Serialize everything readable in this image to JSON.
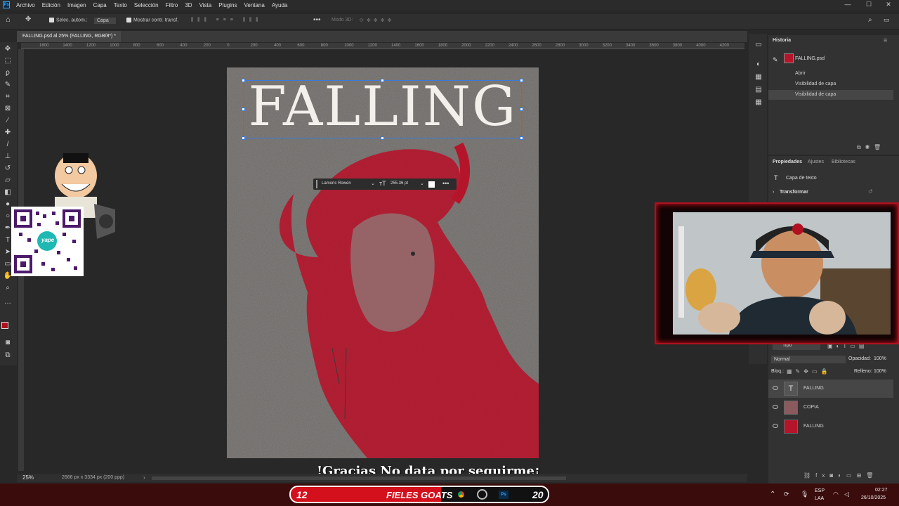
{
  "menubar": {
    "items": [
      "Archivo",
      "Edición",
      "Imagen",
      "Capa",
      "Texto",
      "Selección",
      "Filtro",
      "3D",
      "Vista",
      "Plugins",
      "Ventana",
      "Ayuda"
    ]
  },
  "options": {
    "auto_select_label": "Selec. autom.:",
    "auto_select_value": "Capa",
    "show_transform_label": "Mostrar contr. transf.",
    "mode_3d": "Modo 3D:"
  },
  "document": {
    "tab_title": "FALLING.psd al 25% (FALLING, RGB/8*) *",
    "zoom": "25%",
    "dimensions": "2666 px x 3334 px (200 ppp)",
    "poster_title": "FALLING"
  },
  "ruler": {
    "labels": [
      "1600",
      "1400",
      "1200",
      "1000",
      "800",
      "600",
      "400",
      "200",
      "0",
      "200",
      "400",
      "600",
      "800",
      "1000",
      "1200",
      "1400",
      "1600",
      "1800",
      "2000",
      "2200",
      "2400",
      "2600",
      "2800",
      "3000",
      "3200",
      "3400",
      "3600",
      "3800",
      "4000",
      "4200"
    ]
  },
  "context_bar": {
    "font": "Lamoric Rowen",
    "size": "255.36 pt"
  },
  "history": {
    "title": "Historia",
    "snapshot": "FALLING.psd",
    "steps": [
      "Abrir",
      "Visibilidad de capa",
      "Visibilidad de capa"
    ]
  },
  "properties": {
    "tabs": [
      "Propiedades",
      "Ajustes",
      "Bibliotecas"
    ],
    "layer_type": "Capa de texto",
    "section": "Transformar"
  },
  "layers": {
    "kind_filter": "Tipo",
    "blend_mode": "Normal",
    "opacity_label": "Opacidad:",
    "opacity_value": "100%",
    "lock_label": "Bloq.:",
    "fill_label": "Relleno:",
    "fill_value": "100%",
    "items": [
      {
        "name": "FALLING",
        "type": "text"
      },
      {
        "name": "COPIA",
        "type": "image"
      },
      {
        "name": "FALLING",
        "type": "image"
      }
    ]
  },
  "stream": {
    "caption": "!Gracias No data por seguirme¡",
    "goats_left_number": "12",
    "goats_label": "FIELES GOATS",
    "goats_right_number": "20",
    "qr_brand": "yape"
  },
  "system_tray": {
    "language_top": "ESP",
    "language_bottom": "LAA",
    "time": "02:27",
    "date": "26/10/2025"
  },
  "colors": {
    "accent_red": "#d4101c",
    "selection_blue": "#3b7bd8",
    "foreground_swatch": "#b0101e"
  }
}
